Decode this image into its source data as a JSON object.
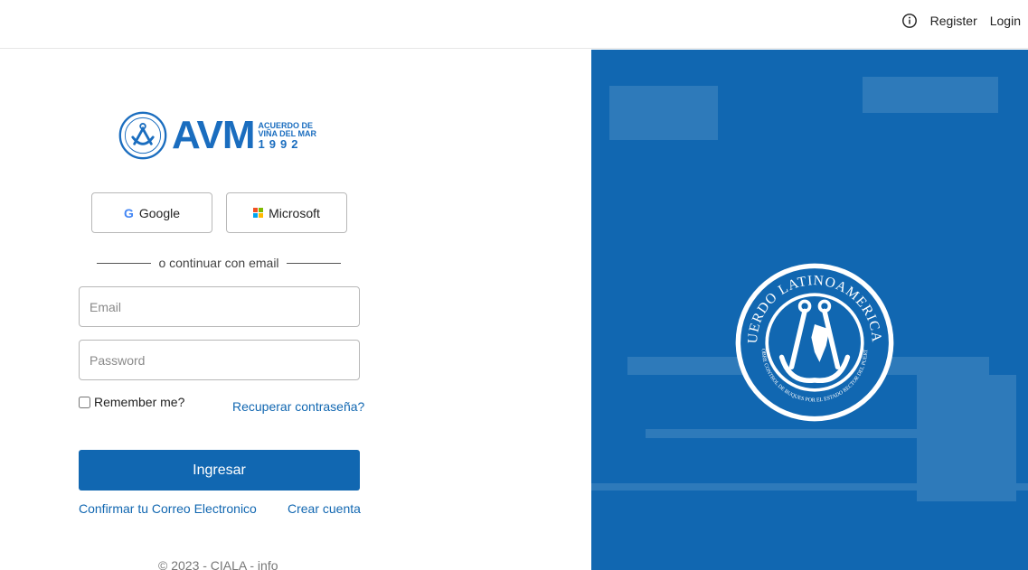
{
  "topnav": {
    "info_icon": "info-circle-icon",
    "register": "Register",
    "login": "Login"
  },
  "logo": {
    "main": "AVM",
    "line1": "ACUERDO DE",
    "line2": "VIÑA DEL MAR",
    "line3": "1992"
  },
  "social": {
    "google": "Google",
    "google_icon": "G",
    "microsoft": "Microsoft"
  },
  "divider": "o continuar con email",
  "form": {
    "email_placeholder": "Email",
    "password_placeholder": "Password",
    "remember": "Remember me?",
    "forgot": "Recuperar contraseña?",
    "submit": "Ingresar"
  },
  "links": {
    "confirm": "Confirmar tu Correo Electronico",
    "create": "Crear cuenta"
  },
  "footer": "© 2023 - CIALA - info",
  "seal": {
    "top_text": "ACUERDO LATINOAMERICANO",
    "bottom_text": "SOBRE CONTROL DE BUQUES POR EL ESTADO RECTOR DEL PUERTO"
  },
  "colors": {
    "primary": "#1167b1",
    "panel": "#1167b1"
  }
}
